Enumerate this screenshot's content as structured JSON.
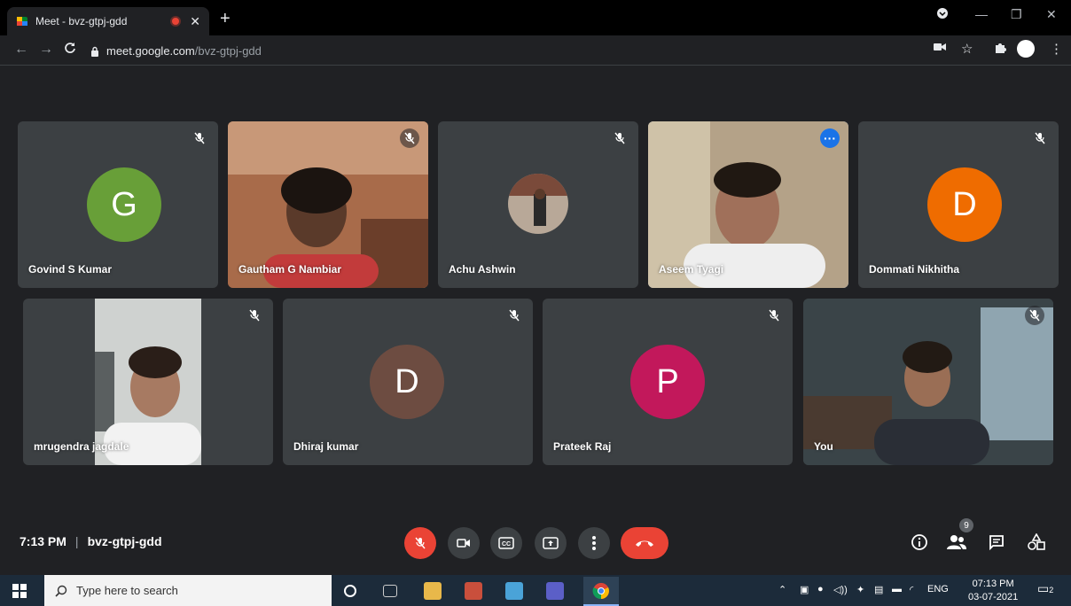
{
  "browser": {
    "tab_title": "Meet - bvz-gtpj-gdd",
    "url_host": "meet.google.com",
    "url_path": "/bvz-gtpj-gdd"
  },
  "participants": [
    {
      "name": "Govind S Kumar",
      "initial": "G",
      "color": "#689f38"
    },
    {
      "name": "Gautham G Nambiar"
    },
    {
      "name": "Achu Ashwin"
    },
    {
      "name": "Aseem Tyagi"
    },
    {
      "name": "Dommati Nikhitha",
      "initial": "D",
      "color": "#ef6c00"
    },
    {
      "name": "mrugendra jagdale"
    },
    {
      "name": "Dhiraj kumar",
      "initial": "D",
      "color": "#6d4c41"
    },
    {
      "name": "Prateek Raj",
      "initial": "P",
      "color": "#c2185b"
    },
    {
      "name": "You"
    }
  ],
  "meeting": {
    "time": "7:13 PM",
    "separator": "|",
    "code": "bvz-gtpj-gdd",
    "people_count": "9"
  },
  "taskbar": {
    "search_placeholder": "Type here to search",
    "lang": "ENG",
    "time": "07:13 PM",
    "date": "03-07-2021",
    "notif_count": "2"
  }
}
